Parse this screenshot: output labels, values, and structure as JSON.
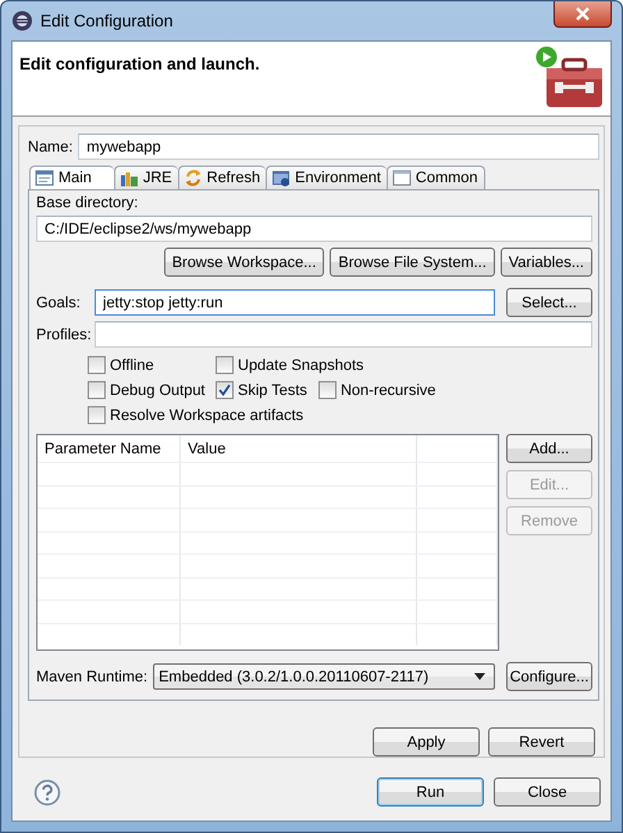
{
  "window": {
    "title": "Edit Configuration"
  },
  "header": {
    "title": "Edit configuration and launch."
  },
  "name": {
    "label": "Name:",
    "value": "mywebapp"
  },
  "tabs": [
    {
      "label": "Main",
      "selected": true,
      "kind": "main"
    },
    {
      "label": "JRE",
      "selected": false,
      "kind": "jre"
    },
    {
      "label": "Refresh",
      "selected": false,
      "kind": "refresh"
    },
    {
      "label": "Environment",
      "selected": false,
      "kind": "environment"
    },
    {
      "label": "Common",
      "selected": false,
      "kind": "common"
    }
  ],
  "base_directory": {
    "label": "Base directory:",
    "value": "C:/IDE/eclipse2/ws/mywebapp",
    "buttons": [
      "Browse Workspace...",
      "Browse File System...",
      "Variables..."
    ]
  },
  "goals": {
    "label": "Goals:",
    "value": "jetty:stop jetty:run",
    "button": "Select..."
  },
  "profiles": {
    "label": "Profiles:"
  },
  "options": [
    [
      {
        "label": "Offline",
        "checked": false
      },
      {
        "label": "Update Snapshots",
        "checked": false
      }
    ],
    [
      {
        "label": "Debug Output",
        "checked": false
      },
      {
        "label": "Skip Tests",
        "checked": true
      },
      {
        "label": "Non-recursive",
        "checked": false
      }
    ],
    [
      {
        "label": "Resolve Workspace artifacts",
        "checked": false
      }
    ]
  ],
  "table": {
    "columns": [
      "Parameter Name",
      "Value"
    ]
  },
  "table_buttons": [
    {
      "label": "Add...",
      "disabled": false
    },
    {
      "label": "Edit...",
      "disabled": true
    },
    {
      "label": "Remove",
      "disabled": true
    }
  ],
  "runtime": {
    "label": "Maven Runtime:",
    "value": "Embedded (3.0.2/1.0.0.20110607-2117)",
    "button": "Configure..."
  },
  "panel_buttons": [
    "Apply",
    "Revert"
  ],
  "dialog_buttons": [
    {
      "label": "Run",
      "default": true
    },
    {
      "label": "Close",
      "default": false
    }
  ]
}
